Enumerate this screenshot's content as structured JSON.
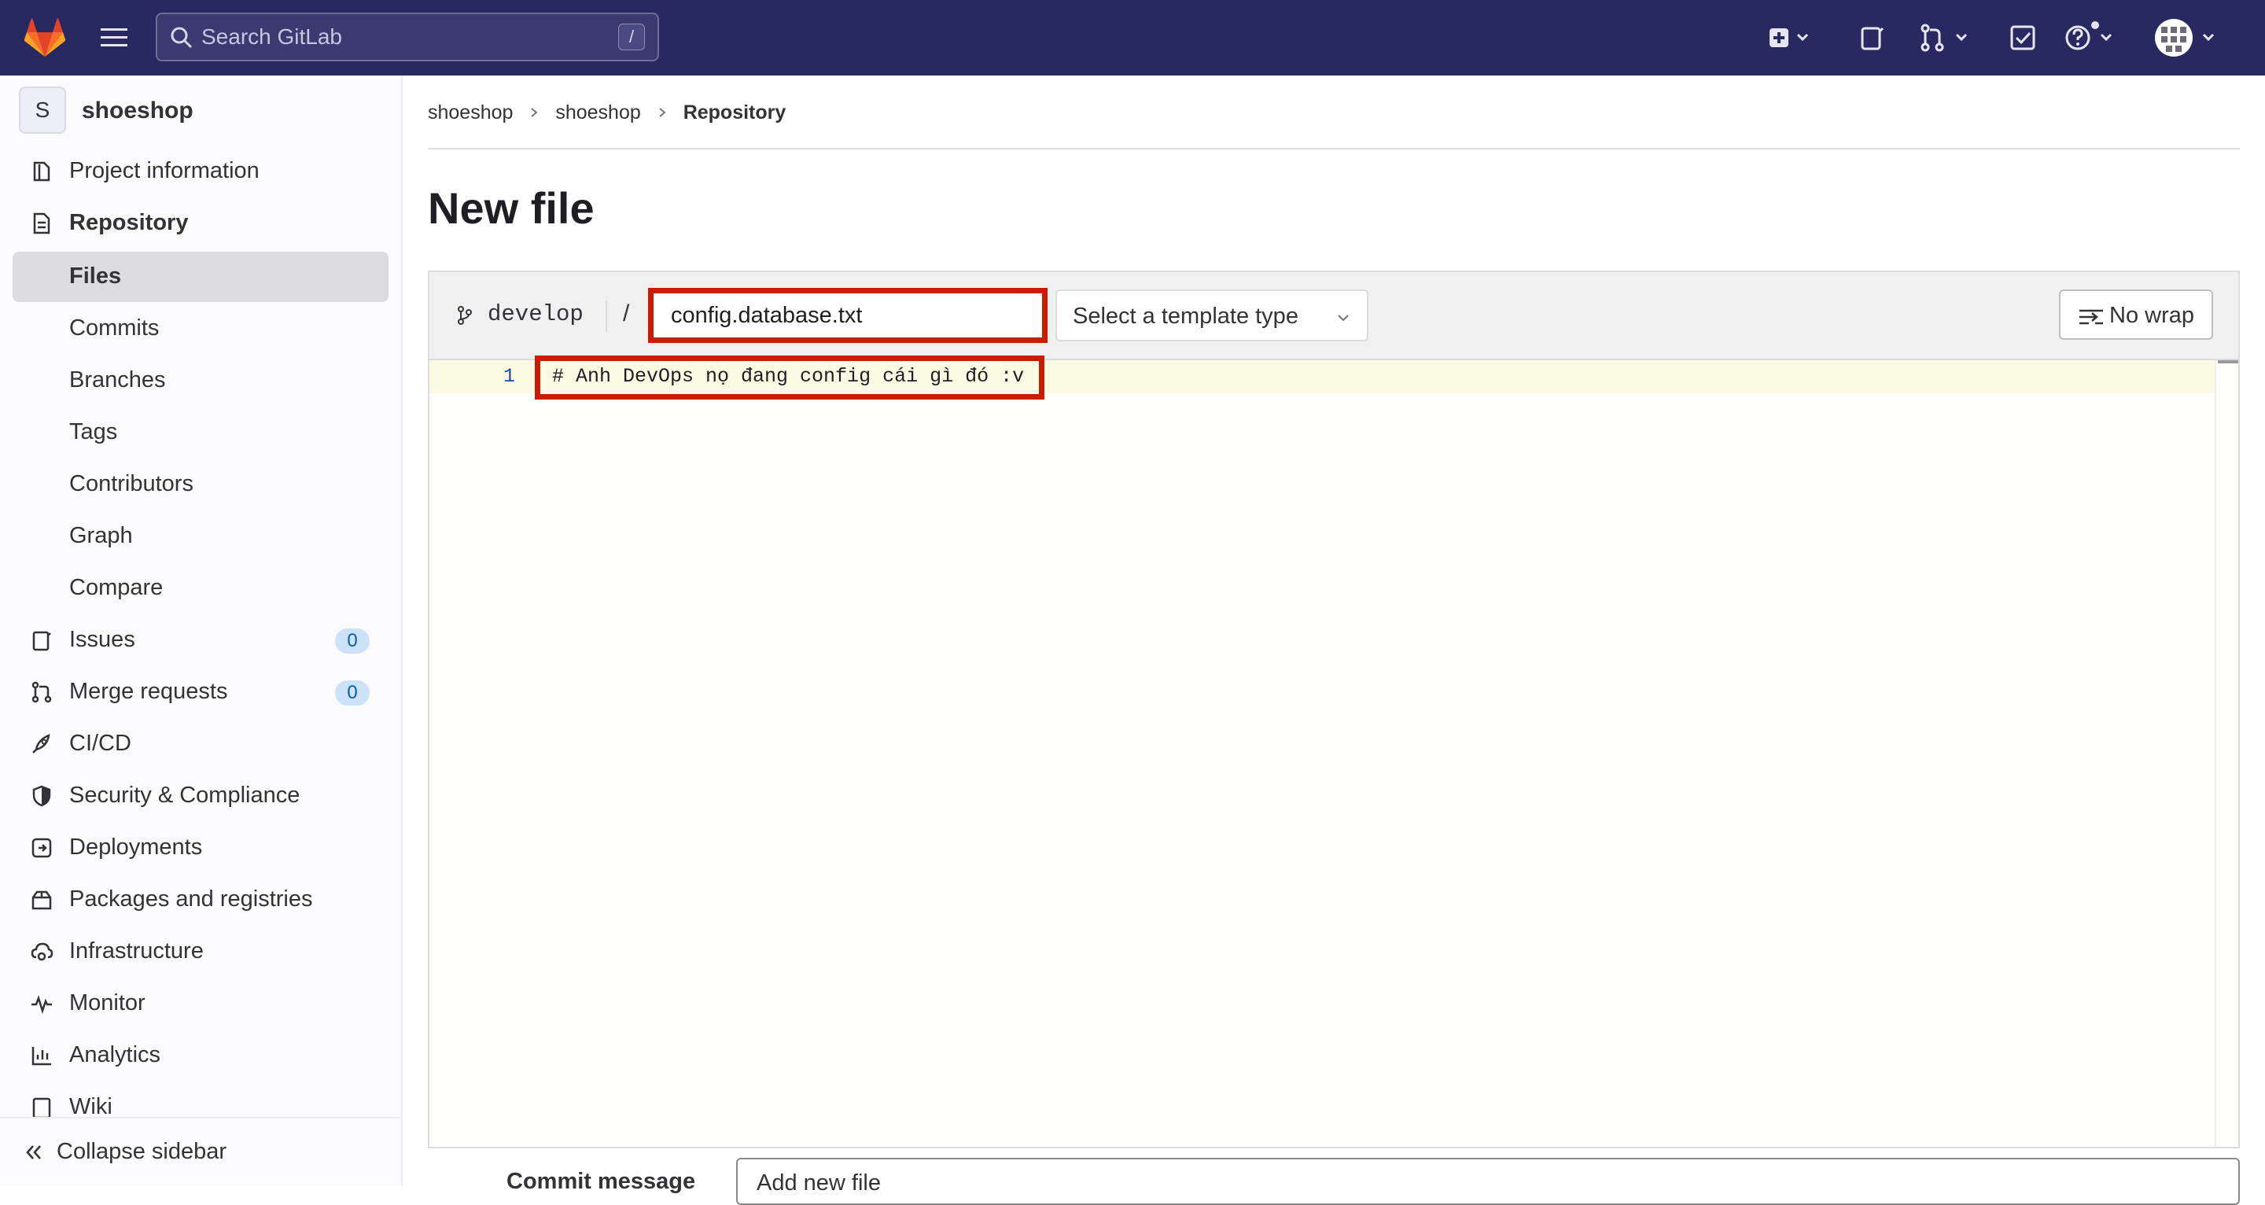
{
  "topbar": {
    "search_placeholder": "Search GitLab",
    "search_shortcut": "/"
  },
  "sidebar": {
    "project_avatar_letter": "S",
    "project_name": "shoeshop",
    "items": [
      {
        "label": "Project information",
        "icon": "project-icon"
      },
      {
        "label": "Repository",
        "icon": "document-icon"
      },
      {
        "label": "Files"
      },
      {
        "label": "Commits"
      },
      {
        "label": "Branches"
      },
      {
        "label": "Tags"
      },
      {
        "label": "Contributors"
      },
      {
        "label": "Graph"
      },
      {
        "label": "Compare"
      },
      {
        "label": "Issues",
        "icon": "issues-icon",
        "count": "0"
      },
      {
        "label": "Merge requests",
        "icon": "merge-request-icon",
        "count": "0"
      },
      {
        "label": "CI/CD",
        "icon": "rocket-icon"
      },
      {
        "label": "Security & Compliance",
        "icon": "shield-icon"
      },
      {
        "label": "Deployments",
        "icon": "deployments-icon"
      },
      {
        "label": "Packages and registries",
        "icon": "package-icon"
      },
      {
        "label": "Infrastructure",
        "icon": "cloud-gear-icon"
      },
      {
        "label": "Monitor",
        "icon": "monitor-icon"
      },
      {
        "label": "Analytics",
        "icon": "chart-icon"
      },
      {
        "label": "Wiki",
        "icon": "book-icon"
      }
    ],
    "collapse_label": "Collapse sidebar"
  },
  "breadcrumb": [
    "shoeshop",
    "shoeshop",
    "Repository"
  ],
  "page_title": "New file",
  "editor": {
    "branch": "develop",
    "path_separator": "/",
    "file_name": "config.database.txt",
    "template_placeholder": "Select a template type",
    "no_wrap_label": "No wrap",
    "lines": [
      {
        "number": "1",
        "text": "# Anh DevOps nọ đang config cái gì đó :v"
      }
    ]
  },
  "commit": {
    "label": "Commit message",
    "value": "Add new file"
  },
  "colors": {
    "topbar": "#292961",
    "highlight_border": "#c91c00",
    "badge_bg": "#cbe2f9",
    "badge_text": "#0b5cad"
  }
}
